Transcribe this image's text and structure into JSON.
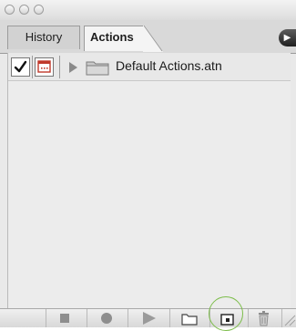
{
  "tabs": [
    {
      "label": "History",
      "active": false
    },
    {
      "label": "Actions",
      "active": true
    }
  ],
  "actions_list": [
    {
      "label": "Default Actions.atn",
      "checked": true,
      "dialog_toggle": true,
      "type": "set"
    }
  ],
  "toolbar": {
    "buttons": [
      "stop-icon",
      "record-icon",
      "play-icon",
      "new-set-icon",
      "new-action-icon",
      "trash-icon"
    ]
  },
  "colors": {
    "dialog_icon_red": "#c0392b",
    "highlight_ring": "#7cbd4a"
  }
}
